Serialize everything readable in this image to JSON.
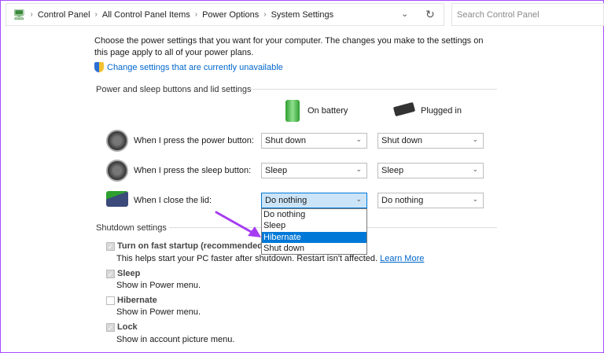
{
  "address": {
    "crumbs": [
      "Control Panel",
      "All Control Panel Items",
      "Power Options",
      "System Settings"
    ]
  },
  "search": {
    "placeholder": "Search Control Panel"
  },
  "intro": "Choose the power settings that you want for your computer. The changes you make to the settings on this page apply to all of your power plans.",
  "change_link": "Change settings that are currently unavailable",
  "section1": "Power and sleep buttons and lid settings",
  "cols": {
    "battery": "On battery",
    "plugged": "Plugged in"
  },
  "rows": [
    {
      "label": "When I press the power button:",
      "battery": "Shut down",
      "plugged": "Shut down"
    },
    {
      "label": "When I press the sleep button:",
      "battery": "Sleep",
      "plugged": "Sleep"
    },
    {
      "label": "When I close the lid:",
      "battery": "Do nothing",
      "plugged": "Do nothing"
    }
  ],
  "dropdown": {
    "options": [
      "Do nothing",
      "Sleep",
      "Hibernate",
      "Shut down"
    ],
    "highlighted": "Hibernate"
  },
  "section2": "Shutdown settings",
  "shutdown": [
    {
      "label": "Turn on fast startup (recommended)",
      "desc": "This helps start your PC faster after shutdown. Restart isn't affected.",
      "checked": true
    },
    {
      "label": "Sleep",
      "desc": "Show in Power menu.",
      "checked": true
    },
    {
      "label": "Hibernate",
      "desc": "Show in Power menu.",
      "checked": false
    },
    {
      "label": "Lock",
      "desc": "Show in account picture menu.",
      "checked": true
    }
  ],
  "learn_more": "Learn More"
}
